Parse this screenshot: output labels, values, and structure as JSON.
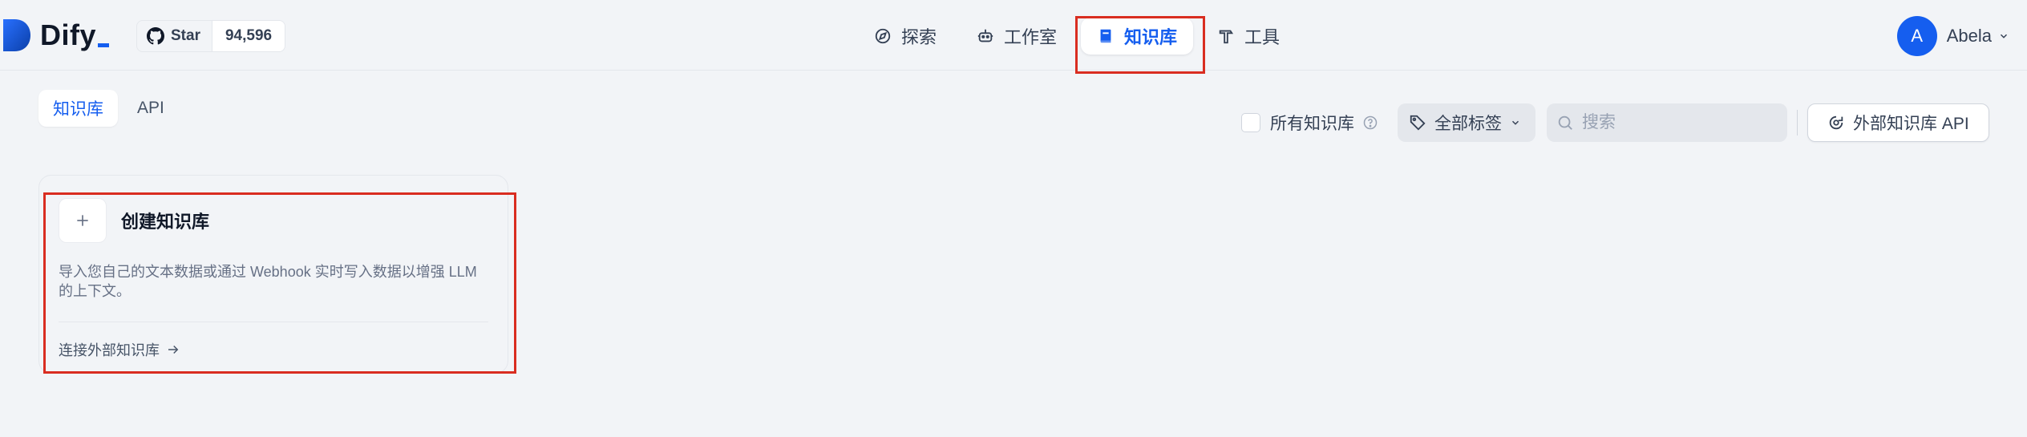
{
  "header": {
    "logo_text": "Dify",
    "github": {
      "star_label": "Star",
      "star_count": "94,596"
    },
    "nav": [
      {
        "label": "探索",
        "icon": "compass-icon"
      },
      {
        "label": "工作室",
        "icon": "robot-icon"
      },
      {
        "label": "知识库",
        "icon": "book-icon",
        "active": true
      },
      {
        "label": "工具",
        "icon": "hammer-icon"
      }
    ],
    "user": {
      "initial": "A",
      "name": "Abela"
    }
  },
  "subtabs": [
    {
      "label": "知识库",
      "active": true
    },
    {
      "label": "API",
      "active": false
    }
  ],
  "filters": {
    "all_datasets_label": "所有知识库",
    "tag_filter_label": "全部标签",
    "search_placeholder": "搜索",
    "external_api_label": "外部知识库 API"
  },
  "create_card": {
    "title": "创建知识库",
    "description": "导入您自己的文本数据或通过 Webhook 实时写入数据以增强 LLM 的上下文。",
    "connect_external_label": "连接外部知识库"
  },
  "colors": {
    "accent": "#155eef",
    "background": "#f2f4f7",
    "highlight": "#d92d20"
  }
}
